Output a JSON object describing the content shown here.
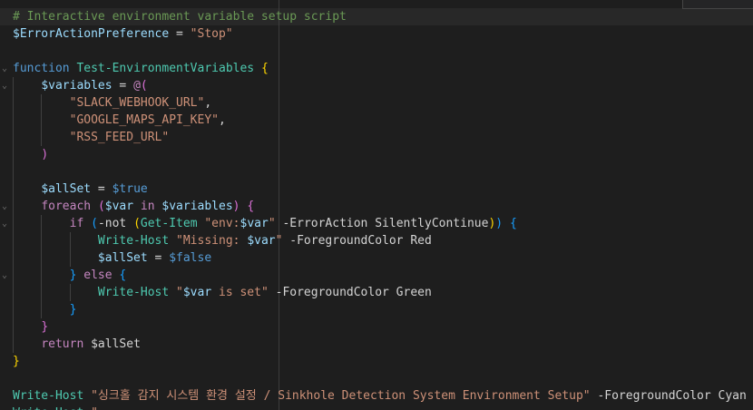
{
  "editor": {
    "lines": [
      {
        "tokens": [
          {
            "t": "# Interactive environment variable setup script",
            "c": "cm"
          }
        ]
      },
      {
        "tokens": [
          {
            "t": "$ErrorActionPreference",
            "c": "vr"
          },
          {
            "t": " = ",
            "c": "op"
          },
          {
            "t": "\"Stop\"",
            "c": "st"
          }
        ]
      },
      {
        "tokens": []
      },
      {
        "tokens": [
          {
            "t": "function",
            "c": "kb"
          },
          {
            "t": " ",
            "c": "op"
          },
          {
            "t": "Test-EnvironmentVariables",
            "c": "fn"
          },
          {
            "t": " ",
            "c": "op"
          },
          {
            "t": "{",
            "c": "br1"
          }
        ]
      },
      {
        "tokens": [
          {
            "t": "    ",
            "c": "op"
          },
          {
            "t": "$variables",
            "c": "vr"
          },
          {
            "t": " = ",
            "c": "op"
          },
          {
            "t": "@",
            "c": "kw"
          },
          {
            "t": "(",
            "c": "br2"
          }
        ]
      },
      {
        "tokens": [
          {
            "t": "        ",
            "c": "op"
          },
          {
            "t": "\"SLACK_WEBHOOK_URL\"",
            "c": "st"
          },
          {
            "t": ",",
            "c": "op"
          }
        ]
      },
      {
        "tokens": [
          {
            "t": "        ",
            "c": "op"
          },
          {
            "t": "\"GOOGLE_MAPS_API_KEY\"",
            "c": "st"
          },
          {
            "t": ",",
            "c": "op"
          }
        ]
      },
      {
        "tokens": [
          {
            "t": "        ",
            "c": "op"
          },
          {
            "t": "\"RSS_FEED_URL\"",
            "c": "st"
          }
        ]
      },
      {
        "tokens": [
          {
            "t": "    ",
            "c": "op"
          },
          {
            "t": ")",
            "c": "br2"
          }
        ]
      },
      {
        "tokens": []
      },
      {
        "tokens": [
          {
            "t": "    ",
            "c": "op"
          },
          {
            "t": "$allSet",
            "c": "vr"
          },
          {
            "t": " = ",
            "c": "op"
          },
          {
            "t": "$true",
            "c": "kb"
          }
        ]
      },
      {
        "tokens": [
          {
            "t": "    ",
            "c": "op"
          },
          {
            "t": "foreach",
            "c": "kw"
          },
          {
            "t": " ",
            "c": "op"
          },
          {
            "t": "(",
            "c": "br2"
          },
          {
            "t": "$var",
            "c": "vr"
          },
          {
            "t": " in ",
            "c": "kw"
          },
          {
            "t": "$variables",
            "c": "vr"
          },
          {
            "t": ")",
            "c": "br2"
          },
          {
            "t": " ",
            "c": "op"
          },
          {
            "t": "{",
            "c": "br2"
          }
        ]
      },
      {
        "tokens": [
          {
            "t": "        ",
            "c": "op"
          },
          {
            "t": "if",
            "c": "kw"
          },
          {
            "t": " ",
            "c": "op"
          },
          {
            "t": "(",
            "c": "br3"
          },
          {
            "t": "-not",
            "c": "op"
          },
          {
            "t": " ",
            "c": "op"
          },
          {
            "t": "(",
            "c": "br1"
          },
          {
            "t": "Get-Item",
            "c": "fn"
          },
          {
            "t": " ",
            "c": "op"
          },
          {
            "t": "\"env:",
            "c": "st"
          },
          {
            "t": "$var",
            "c": "vr"
          },
          {
            "t": "\"",
            "c": "st"
          },
          {
            "t": " ",
            "c": "op"
          },
          {
            "t": "-ErrorAction SilentlyContinue",
            "c": "op"
          },
          {
            "t": ")",
            "c": "br1"
          },
          {
            "t": ")",
            "c": "br3"
          },
          {
            "t": " ",
            "c": "op"
          },
          {
            "t": "{",
            "c": "br3"
          }
        ]
      },
      {
        "tokens": [
          {
            "t": "            ",
            "c": "op"
          },
          {
            "t": "Write-Host",
            "c": "fn"
          },
          {
            "t": " ",
            "c": "op"
          },
          {
            "t": "\"Missing: ",
            "c": "st"
          },
          {
            "t": "$var",
            "c": "vr"
          },
          {
            "t": "\"",
            "c": "st"
          },
          {
            "t": " ",
            "c": "op"
          },
          {
            "t": "-ForegroundColor Red",
            "c": "op"
          }
        ]
      },
      {
        "tokens": [
          {
            "t": "            ",
            "c": "op"
          },
          {
            "t": "$allSet",
            "c": "vr"
          },
          {
            "t": " = ",
            "c": "op"
          },
          {
            "t": "$false",
            "c": "kb"
          }
        ]
      },
      {
        "tokens": [
          {
            "t": "        ",
            "c": "op"
          },
          {
            "t": "}",
            "c": "br3"
          },
          {
            "t": " ",
            "c": "op"
          },
          {
            "t": "else",
            "c": "kw"
          },
          {
            "t": " ",
            "c": "op"
          },
          {
            "t": "{",
            "c": "br3"
          }
        ]
      },
      {
        "tokens": [
          {
            "t": "            ",
            "c": "op"
          },
          {
            "t": "Write-Host",
            "c": "fn"
          },
          {
            "t": " ",
            "c": "op"
          },
          {
            "t": "\"",
            "c": "st"
          },
          {
            "t": "$var",
            "c": "vr"
          },
          {
            "t": " is set\"",
            "c": "st"
          },
          {
            "t": " ",
            "c": "op"
          },
          {
            "t": "-ForegroundColor Green",
            "c": "op"
          }
        ]
      },
      {
        "tokens": [
          {
            "t": "        ",
            "c": "op"
          },
          {
            "t": "}",
            "c": "br3"
          }
        ]
      },
      {
        "tokens": [
          {
            "t": "    ",
            "c": "op"
          },
          {
            "t": "}",
            "c": "br2"
          }
        ]
      },
      {
        "tokens": [
          {
            "t": "    ",
            "c": "op"
          },
          {
            "t": "return",
            "c": "kw"
          },
          {
            "t": " ",
            "c": "op"
          },
          {
            "t": "$allSet",
            "c": "op"
          }
        ]
      },
      {
        "tokens": [
          {
            "t": "}",
            "c": "br1"
          }
        ]
      },
      {
        "tokens": []
      },
      {
        "tokens": [
          {
            "t": "Write-Host",
            "c": "fn"
          },
          {
            "t": " ",
            "c": "op"
          },
          {
            "t": "\"싱크홀 감지 시스템 환경 설정 / Sinkhole Detection System Environment Setup\"",
            "c": "st"
          },
          {
            "t": " ",
            "c": "op"
          },
          {
            "t": "-ForegroundColor Cyan",
            "c": "op"
          }
        ]
      },
      {
        "tokens": [
          {
            "t": "Write-Host",
            "c": "fn"
          },
          {
            "t": " ",
            "c": "op"
          },
          {
            "t": "\"",
            "c": "st"
          }
        ]
      }
    ],
    "folds": [
      {
        "line": 3,
        "glyph": "⌄"
      },
      {
        "line": 4,
        "glyph": "⌄"
      },
      {
        "line": 11,
        "glyph": "⌄"
      },
      {
        "line": 12,
        "glyph": "⌄"
      },
      {
        "line": 15,
        "glyph": "⌄"
      }
    ]
  }
}
